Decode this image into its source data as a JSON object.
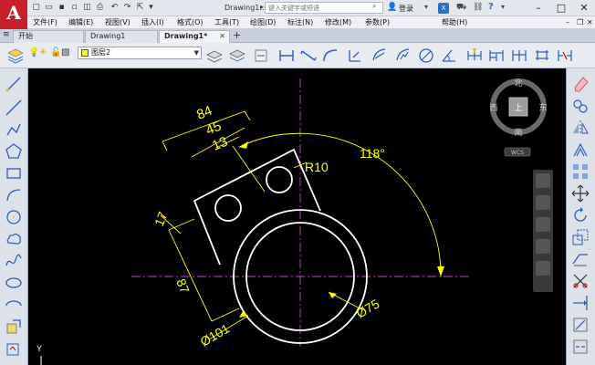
{
  "title_bar": {
    "document_title": "Drawing1...",
    "search_placeholder": "键入关键字或短语",
    "login_label": "登录"
  },
  "menu": [
    "文件(F)",
    "编辑(E)",
    "视图(V)",
    "插入(I)",
    "格式(O)",
    "工具(T)",
    "绘图(D)",
    "标注(N)",
    "修改(M)",
    "参数(P)",
    "帮助(H)"
  ],
  "tabs": [
    {
      "label": "开始",
      "active": false
    },
    {
      "label": "Drawing1",
      "active": false
    },
    {
      "label": "Drawing1*",
      "active": true
    }
  ],
  "layer": {
    "name": "图层2",
    "color": "#ffff00"
  },
  "drawing": {
    "dim_84": "84",
    "dim_45": "45",
    "dim_13": "13",
    "dim_r10": "R10",
    "dim_angle": "118°",
    "dim_17": "17",
    "dim_87": "87",
    "dim_d101": "Ø101",
    "dim_d75": "Ø75",
    "ucs_y": "Y",
    "dim_color": "#ffff00",
    "object_color": "#ffffff",
    "center_color": "#c04dc0"
  },
  "viewcube": {
    "north": "北",
    "south": "南",
    "east": "东",
    "west": "西",
    "top": "上",
    "wcs": "WCS"
  }
}
